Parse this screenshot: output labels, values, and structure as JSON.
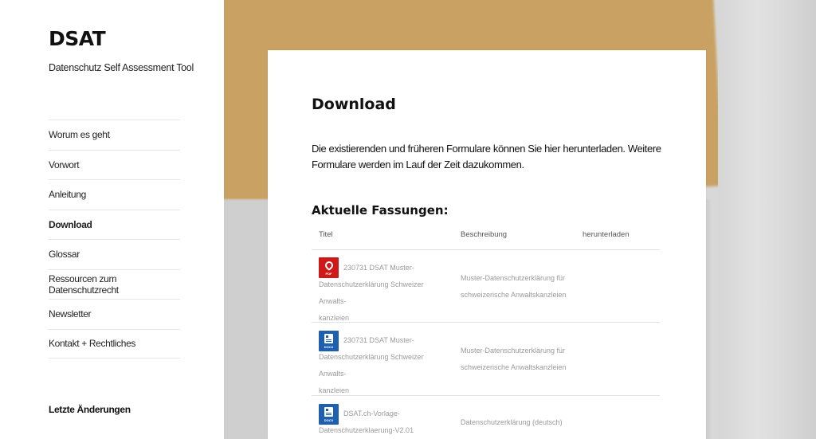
{
  "site": {
    "title": "DSAT",
    "description": "Datenschutz Self Assessment Tool"
  },
  "nav": {
    "items": [
      {
        "label": "Worum es geht",
        "active": false
      },
      {
        "label": "Vorwort",
        "active": false
      },
      {
        "label": "Anleitung",
        "active": false
      },
      {
        "label": "Download",
        "active": true
      },
      {
        "label": "Glossar",
        "active": false
      },
      {
        "label": "Ressourcen zum Datenschutzrecht",
        "active": false
      },
      {
        "label": "Newsletter",
        "active": false
      },
      {
        "label": "Kontakt + Rechtliches",
        "active": false
      }
    ],
    "recent_label": "Letzte Änderungen"
  },
  "main": {
    "title": "Download",
    "intro": "Die existierenden und früheren Formulare können Sie hier herunterladen. Weitere Formulare werden im Lauf der Zeit dazukommen.",
    "section_title": "Aktuelle Fassungen:",
    "table": {
      "headers": {
        "title": "Titel",
        "description": "Beschreibung",
        "download": "herunterladen"
      },
      "rows": [
        {
          "icon": "pdf-file-icon",
          "icon_tag": "PDF",
          "title_line1": "230731 DSAT Muster-",
          "title_line2": "Datenschutzerklärung Schweizer Anwalts-",
          "title_line3": "kanzleien",
          "desc_line1": "Muster-Datenschutzerklärung für",
          "desc_line2": "schweizerische Anwaltskanzleien"
        },
        {
          "icon": "docx-file-icon",
          "icon_tag": "DOCX",
          "title_line1": "230731 DSAT Muster-",
          "title_line2": "Datenschutzerklärung Schweizer Anwalts-",
          "title_line3": "kanzleien",
          "desc_line1": "Muster-Datenschutzerklärung für",
          "desc_line2": "schweizerische Anwaltskanzleien"
        },
        {
          "icon": "docx-file-icon",
          "icon_tag": "DOCX",
          "title_line1": "DSAT.ch-Vorlage-",
          "title_line2": "Datenschutzerklaerung-V2.01",
          "desc_line1": "Datenschutzerklärung (deutsch)"
        }
      ]
    }
  },
  "colors": {
    "pdf_red": "#d01818",
    "docx_blue": "#1f5fb0",
    "background_paper": "#c9a162"
  }
}
